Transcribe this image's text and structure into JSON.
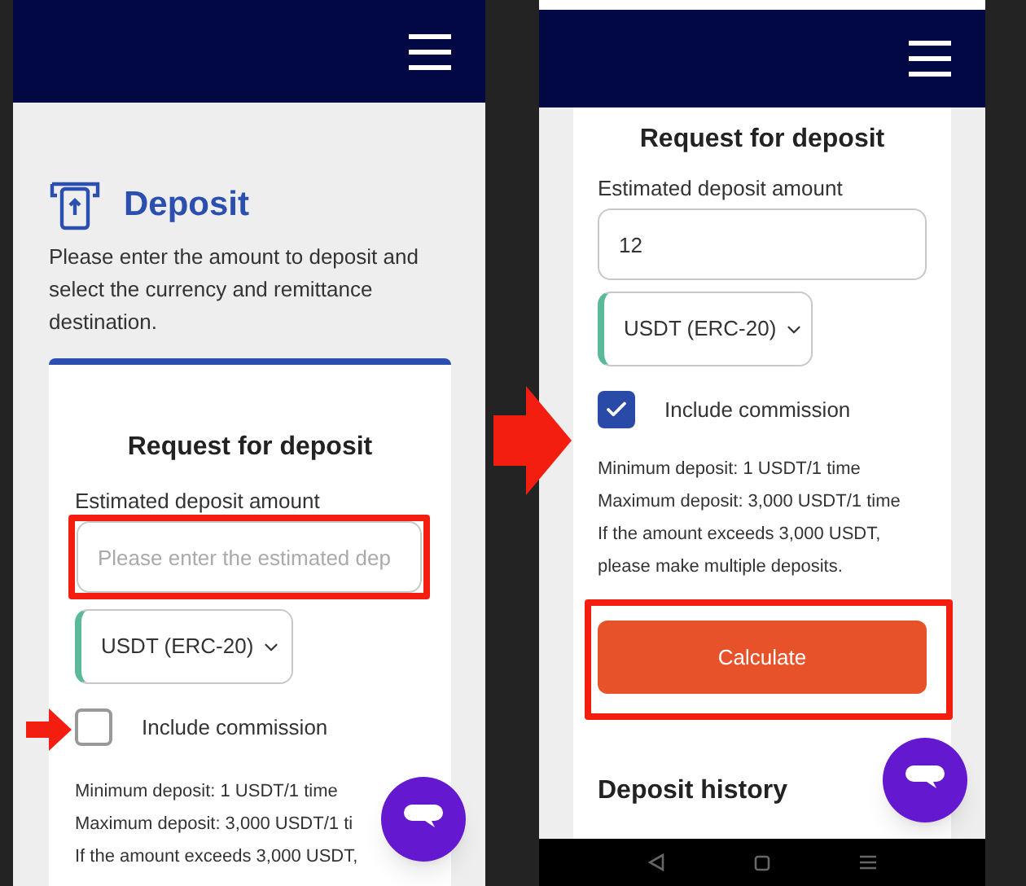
{
  "left_screen": {
    "page_title": "Deposit",
    "description": "Please enter the amount to deposit and select the currency and remittance destination.",
    "card": {
      "heading": "Request for deposit",
      "amount_label": "Estimated deposit amount",
      "amount_field": {
        "placeholder": "Please enter the estimated dep"
      },
      "currency": "USDT (ERC-20)",
      "commission": {
        "label": "Include commission",
        "checked": false
      },
      "notes": [
        "Minimum deposit: 1 USDT/1 time",
        "Maximum deposit: 3,000 USDT/1 ti",
        "If the amount exceeds 3,000 USDT,"
      ]
    }
  },
  "right_screen": {
    "card": {
      "heading": "Request for deposit",
      "amount_label": "Estimated deposit amount",
      "amount_field": {
        "value": "12"
      },
      "currency": "USDT (ERC-20)",
      "commission": {
        "label": "Include commission",
        "checked": true
      },
      "notes": [
        "Minimum deposit: 1 USDT/1 time",
        "Maximum deposit: 3,000 USDT/1 time",
        "If the amount exceeds 3,000 USDT,",
        "please make multiple deposits."
      ],
      "calculate_button": "Calculate"
    },
    "history_heading": "Deposit history"
  }
}
